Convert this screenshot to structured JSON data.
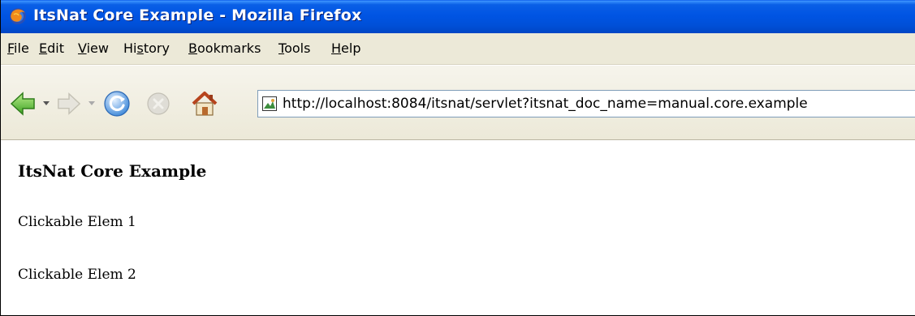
{
  "window": {
    "title": "ItsNat Core Example - Mozilla Firefox"
  },
  "menu": {
    "items": [
      {
        "label_pre": "",
        "label_u": "F",
        "label_post": "ile"
      },
      {
        "label_pre": "",
        "label_u": "E",
        "label_post": "dit"
      },
      {
        "label_pre": "",
        "label_u": "V",
        "label_post": "iew"
      },
      {
        "label_pre": "Hi",
        "label_u": "s",
        "label_post": "tory"
      },
      {
        "label_pre": "",
        "label_u": "B",
        "label_post": "ookmarks"
      },
      {
        "label_pre": "",
        "label_u": "T",
        "label_post": "ools"
      },
      {
        "label_pre": "",
        "label_u": "H",
        "label_post": "elp"
      }
    ]
  },
  "toolbar": {
    "back_icon": "back-arrow-icon",
    "forward_icon": "forward-arrow-icon",
    "reload_icon": "reload-icon",
    "stop_icon": "stop-icon",
    "home_icon": "home-icon",
    "url": "http://localhost:8084/itsnat/servlet?itsnat_doc_name=manual.core.example"
  },
  "page": {
    "heading": "ItsNat Core Example",
    "elems": [
      "Clickable Elem 1",
      "Clickable Elem 2"
    ]
  },
  "colors": {
    "titlebar": "#0054e3",
    "chrome": "#ece9d8"
  }
}
